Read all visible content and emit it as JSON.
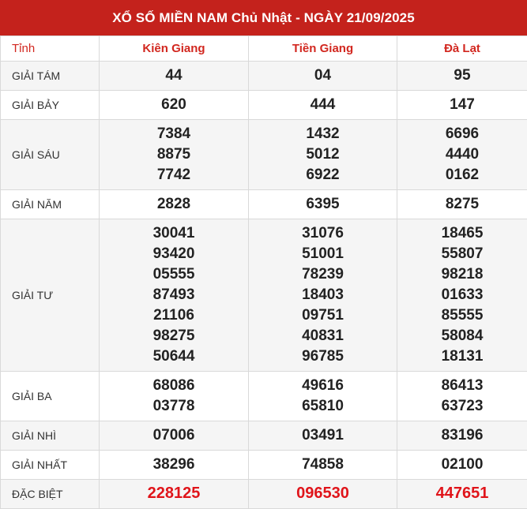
{
  "title": "XỔ SỐ MIỀN NAM Chủ Nhật - NGÀY 21/09/2025",
  "header_label": "Tỉnh",
  "provinces": [
    "Kiên Giang",
    "Tiền Giang",
    "Đà Lạt"
  ],
  "prizes": [
    {
      "label": "GIẢI TÁM",
      "values": [
        [
          "44"
        ],
        [
          "04"
        ],
        [
          "95"
        ]
      ]
    },
    {
      "label": "GIẢI BẢY",
      "values": [
        [
          "620"
        ],
        [
          "444"
        ],
        [
          "147"
        ]
      ]
    },
    {
      "label": "GIẢI SÁU",
      "values": [
        [
          "7384",
          "8875",
          "7742"
        ],
        [
          "1432",
          "5012",
          "6922"
        ],
        [
          "6696",
          "4440",
          "0162"
        ]
      ]
    },
    {
      "label": "GIẢI NĂM",
      "values": [
        [
          "2828"
        ],
        [
          "6395"
        ],
        [
          "8275"
        ]
      ]
    },
    {
      "label": "GIẢI TƯ",
      "values": [
        [
          "30041",
          "93420",
          "05555",
          "87493",
          "21106",
          "98275",
          "50644"
        ],
        [
          "31076",
          "51001",
          "78239",
          "18403",
          "09751",
          "40831",
          "96785"
        ],
        [
          "18465",
          "55807",
          "98218",
          "01633",
          "85555",
          "58084",
          "18131"
        ]
      ]
    },
    {
      "label": "GIẢI BA",
      "values": [
        [
          "68086",
          "03778"
        ],
        [
          "49616",
          "65810"
        ],
        [
          "86413",
          "63723"
        ]
      ]
    },
    {
      "label": "GIẢI NHÌ",
      "values": [
        [
          "07006"
        ],
        [
          "03491"
        ],
        [
          "83196"
        ]
      ]
    },
    {
      "label": "GIẢI NHẤT",
      "values": [
        [
          "38296"
        ],
        [
          "74858"
        ],
        [
          "02100"
        ]
      ]
    },
    {
      "label": "ĐẶC BIỆT",
      "values": [
        [
          "228125"
        ],
        [
          "096530"
        ],
        [
          "447651"
        ]
      ]
    }
  ],
  "colors": {
    "header_bg": "#c4221c",
    "province_text": "#d2271f",
    "special_text": "#e0141a",
    "alt_row_bg": "#f5f5f5"
  }
}
